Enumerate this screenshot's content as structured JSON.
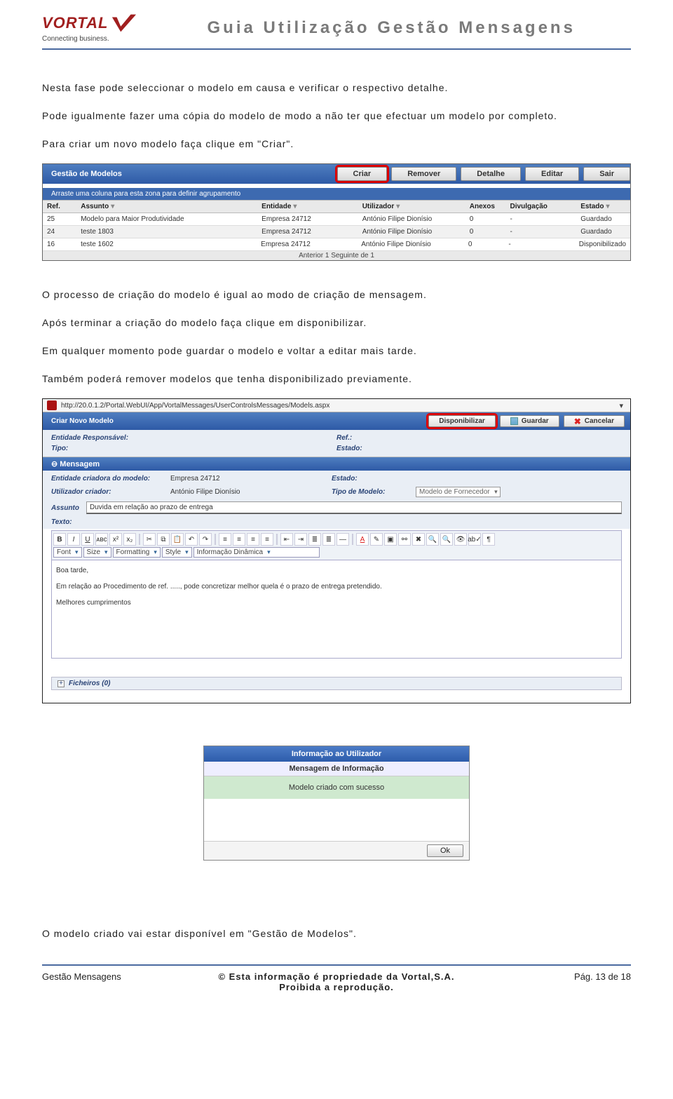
{
  "header": {
    "logo_text": "VORTAL",
    "logo_tag": "Connecting business.",
    "doc_title": "Guia Utilização Gestão Mensagens"
  },
  "paragraphs": {
    "p1": "Nesta fase pode seleccionar o modelo em causa e verificar o respectivo detalhe.",
    "p2": "Pode igualmente fazer uma cópia do modelo de modo a não ter que efectuar um modelo por completo.",
    "p3": "Para criar um novo modelo faça clique em \"Criar\".",
    "p4": "O processo de criação do modelo é igual ao modo de criação de mensagem.",
    "p5": "Após terminar a criação do modelo faça clique em disponibilizar.",
    "p6": "Em qualquer momento pode guardar o modelo e voltar a editar mais tarde.",
    "p7": "Também poderá remover modelos que tenha disponibilizado previamente.",
    "p8": "O modelo criado vai estar disponível em \"Gestão de Modelos\"."
  },
  "shot1": {
    "title": "Gestão de Modelos",
    "buttons": {
      "criar": "Criar",
      "remover": "Remover",
      "detalhe": "Detalhe",
      "editar": "Editar",
      "sair": "Sair"
    },
    "drag_hint": "Arraste uma coluna para esta zona para definir agrupamento",
    "headers": {
      "ref": "Ref.",
      "assunto": "Assunto",
      "entidade": "Entidade",
      "utilizador": "Utilizador",
      "anexos": "Anexos",
      "divulgacao": "Divulgação",
      "estado": "Estado"
    },
    "rows": [
      {
        "ref": "25",
        "assunto": "Modelo para Maior Produtividade",
        "entidade": "Empresa 24712",
        "utilizador": "António Filipe Dionísio",
        "anexos": "0",
        "divulgacao": "-",
        "estado": "Guardado"
      },
      {
        "ref": "24",
        "assunto": "teste 1803",
        "entidade": "Empresa 24712",
        "utilizador": "António Filipe Dionísio",
        "anexos": "0",
        "divulgacao": "-",
        "estado": "Guardado"
      },
      {
        "ref": "16",
        "assunto": "teste 1602",
        "entidade": "Empresa 24712",
        "utilizador": "António Filipe Dionísio",
        "anexos": "0",
        "divulgacao": "-",
        "estado": "Disponibilizado"
      }
    ],
    "pager": "Anterior 1 Seguinte de 1"
  },
  "shot2": {
    "url": "http://20.0.1.2/Portal.WebUI/App/VortalMessages/UserControlsMessages/Models.aspx",
    "bar_title": "Criar Novo Modelo",
    "buttons": {
      "disponibilizar": "Disponibilizar",
      "guardar": "Guardar",
      "cancelar": "Cancelar"
    },
    "meta": {
      "entidade_resp_lbl": "Entidade Responsável:",
      "ref_lbl": "Ref.:",
      "tipo_lbl": "Tipo:",
      "estado_lbl": "Estado:"
    },
    "section_msg": "Mensagem",
    "msg": {
      "ent_criadora_lbl": "Entidade criadora do modelo:",
      "ent_criadora_val": "Empresa 24712",
      "estado_lbl": "Estado:",
      "util_criador_lbl": "Utilizador criador:",
      "util_criador_val": "António Filipe Dionísio",
      "tipo_modelo_lbl": "Tipo de Modelo:",
      "tipo_modelo_val": "Modelo de Fornecedor",
      "assunto_lbl": "Assunto",
      "assunto_val": "Duvida em relação ao prazo de entrega",
      "texto_lbl": "Texto:"
    },
    "toolbar": {
      "font": "Font",
      "size": "Size",
      "formatting": "Formatting",
      "style": "Style",
      "dyn": "Informação Dinâmica"
    },
    "editor": {
      "l1": "Boa tarde,",
      "l2": "Em relação ao Procedimento de ref. ....., pode concretizar melhor quela é o prazo de entrega pretendido.",
      "l3": "Melhores cumprimentos"
    },
    "files": "Ficheiros (0)"
  },
  "dialog": {
    "title": "Informação ao Utilizador",
    "subtitle": "Mensagem de Informação",
    "body": "Modelo criado com sucesso",
    "ok": "Ok"
  },
  "footer": {
    "left": "Gestão Mensagens",
    "c1": "© Esta informação é propriedade da Vortal,S.A.",
    "c2": "Proibida a reprodução.",
    "right": "Pág. 13 de 18"
  }
}
